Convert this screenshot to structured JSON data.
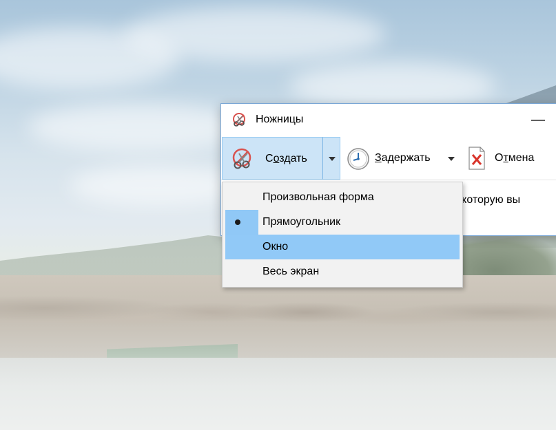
{
  "window": {
    "title": "Ножницы",
    "minimize_symbol": "—"
  },
  "toolbar": {
    "new": {
      "label_pre": "С",
      "label_mnemonic": "о",
      "label_post": "здать",
      "icon": "scissors-icon"
    },
    "new_dropdown_icon": "chevron-down-icon",
    "delay": {
      "label_pre": "",
      "label_mnemonic": "З",
      "label_post": "адержать",
      "icon": "clock-icon"
    },
    "cancel": {
      "label_pre": "О",
      "label_mnemonic": "т",
      "label_post": "мена",
      "icon": "cancel-icon"
    }
  },
  "hint": {
    "text": "ти, которую вы"
  },
  "mode_menu": {
    "items": [
      {
        "label": "Произвольная форма",
        "selected": false,
        "highlighted": false
      },
      {
        "label": "Прямоугольник",
        "selected": true,
        "highlighted": false
      },
      {
        "label": "Окно",
        "selected": false,
        "highlighted": true
      },
      {
        "label": "Весь экран",
        "selected": false,
        "highlighted": false
      }
    ]
  },
  "colors": {
    "button_active_bg": "#cce4f7",
    "menu_highlight": "#91c9f7",
    "menu_bg": "#f2f2f2",
    "window_border": "#7aa7d6"
  }
}
